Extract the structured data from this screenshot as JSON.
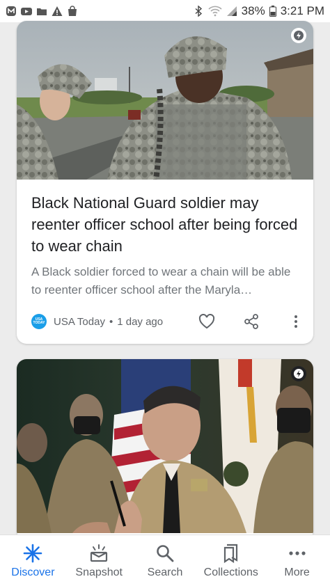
{
  "status_bar": {
    "battery": "38%",
    "time": "3:21 PM",
    "left_icons": [
      "app-m-icon",
      "youtube-icon",
      "folder-icon",
      "warning-icon",
      "shopping-bag-icon"
    ],
    "right_icons": [
      "bluetooth-icon",
      "wifi-icon",
      "signal-icon",
      "battery-icon"
    ]
  },
  "feed": {
    "cards": [
      {
        "headline": "Black National Guard soldier may reenter officer school after being forced to wear chain",
        "snippet": "A Black soldier forced to wear a chain will be able to reenter officer school after the Maryla…",
        "source": "USA Today",
        "source_logo_text": "USA TODAY",
        "separator": "•",
        "age": "1 day ago",
        "badge": "amp-lightning-icon"
      },
      {
        "badge": "amp-lightning-icon"
      }
    ]
  },
  "bottom_nav": {
    "items": [
      {
        "label": "Discover",
        "icon": "discover-asterisk-icon",
        "active": true
      },
      {
        "label": "Snapshot",
        "icon": "snapshot-icon",
        "active": false
      },
      {
        "label": "Search",
        "icon": "search-icon",
        "active": false
      },
      {
        "label": "Collections",
        "icon": "collections-icon",
        "active": false
      },
      {
        "label": "More",
        "icon": "more-dots-icon",
        "active": false
      }
    ]
  },
  "colors": {
    "accent": "#1a73e8",
    "text_primary": "#202124",
    "text_secondary": "#70757a",
    "background": "#ececec",
    "usa_today_blue": "#1a9ee8"
  }
}
